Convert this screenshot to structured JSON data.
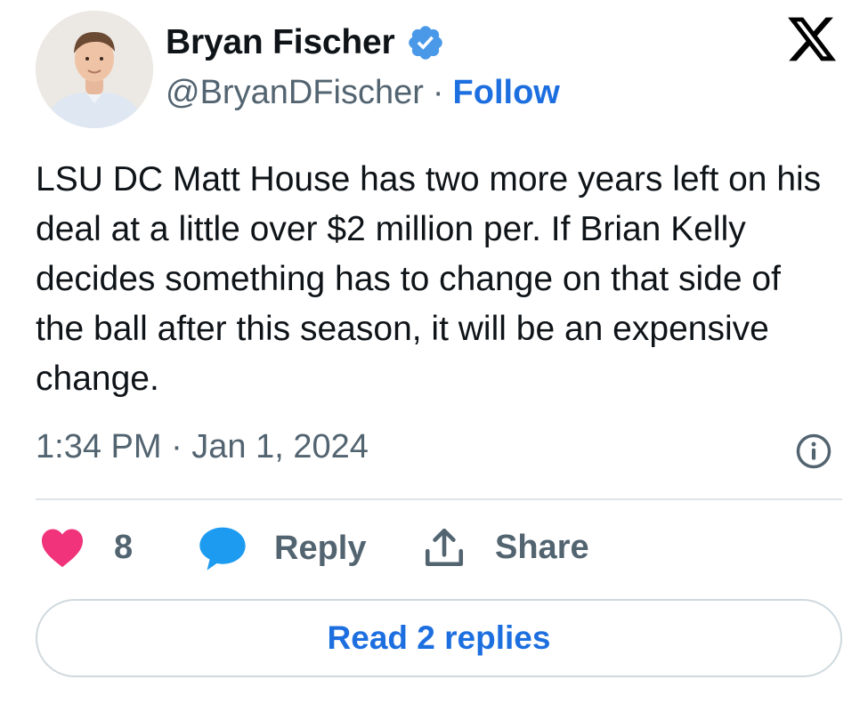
{
  "author": {
    "name": "Bryan Fischer",
    "handle": "@BryanDFischer",
    "separator": "·",
    "follow_label": "Follow",
    "verified": true,
    "verified_color": "#4a99e9"
  },
  "tweet": {
    "text": "LSU DC Matt House has two more years left on his deal at a little over $2 million per. If Brian Kelly decides something has to change on that side of the ball after this season, it will be an expensive change.",
    "timestamp": "1:34 PM · Jan 1, 2024"
  },
  "actions": {
    "like_count": "8",
    "reply_label": "Reply",
    "share_label": "Share"
  },
  "read_replies_label": "Read 2 replies",
  "icons": {
    "platform": "x-logo-icon",
    "verified": "verified-badge-icon",
    "info": "info-icon",
    "like": "heart-icon",
    "reply": "speech-bubble-icon",
    "share": "share-upload-icon"
  },
  "colors": {
    "accent": "#1d6fe0",
    "heart": "#f0337a",
    "reply_bubble": "#1d9bf0",
    "secondary_text": "#536471"
  }
}
